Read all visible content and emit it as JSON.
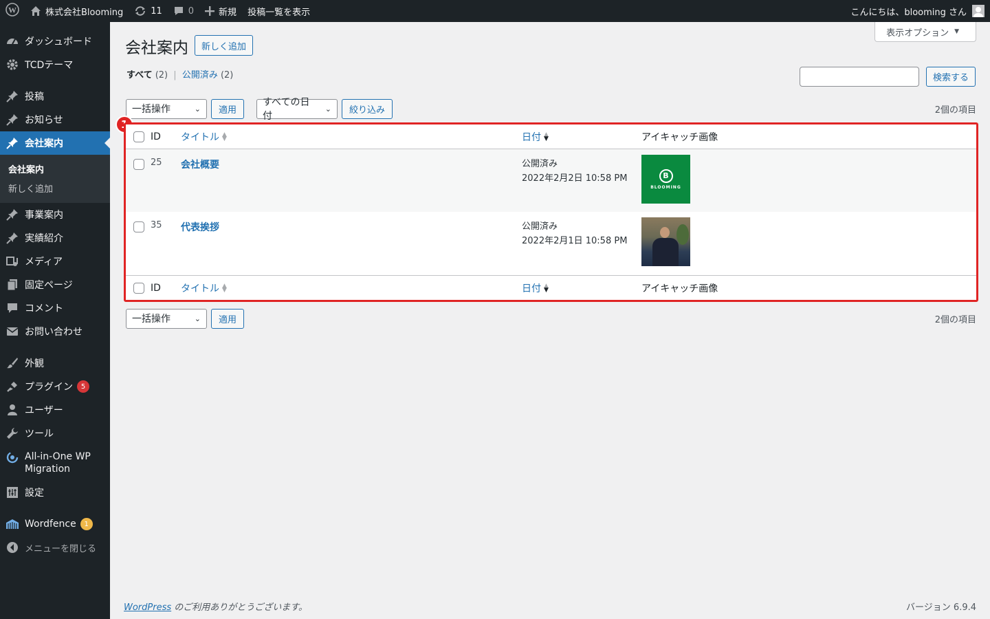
{
  "adminbar": {
    "site_name": "株式会社Blooming",
    "updates_count": "11",
    "comments_count": "0",
    "new_label": "新規",
    "view_posts_label": "投稿一覧を表示",
    "greeting": "こんにちは、blooming さん"
  },
  "sidebar": {
    "items": [
      {
        "label": "ダッシュボード",
        "icon": "dashboard-icon"
      },
      {
        "label": "TCDテーマ",
        "icon": "gear-icon"
      },
      {
        "label": "投稿",
        "icon": "pin-icon"
      },
      {
        "label": "お知らせ",
        "icon": "pin-icon"
      },
      {
        "label": "会社案内",
        "icon": "pin-icon",
        "current": true
      },
      {
        "label": "事業案内",
        "icon": "pin-icon"
      },
      {
        "label": "実績紹介",
        "icon": "pin-icon"
      },
      {
        "label": "メディア",
        "icon": "media-icon"
      },
      {
        "label": "固定ページ",
        "icon": "page-icon"
      },
      {
        "label": "コメント",
        "icon": "comment-icon"
      },
      {
        "label": "お問い合わせ",
        "icon": "mail-icon"
      },
      {
        "label": "外観",
        "icon": "brush-icon"
      },
      {
        "label": "プラグイン",
        "icon": "plugin-icon",
        "badge": "5"
      },
      {
        "label": "ユーザー",
        "icon": "user-icon"
      },
      {
        "label": "ツール",
        "icon": "wrench-icon"
      },
      {
        "label": "All-in-One WP Migration",
        "icon": "migration-icon"
      },
      {
        "label": "設定",
        "icon": "settings-icon"
      },
      {
        "label": "Wordfence",
        "icon": "wordfence-icon",
        "badge": "1"
      },
      {
        "label": "メニューを閉じる",
        "icon": "collapse-icon"
      }
    ],
    "submenu": [
      "会社案内",
      "新しく追加"
    ]
  },
  "screen_options": "表示オプション",
  "page_title": "会社案内",
  "add_new": "新しく追加",
  "filters": {
    "all_label": "すべて",
    "all_count": "(2)",
    "published_label": "公開済み",
    "published_count": "(2)",
    "separator": "|"
  },
  "search": {
    "button": "検索する",
    "value": ""
  },
  "bulk_action": "一括操作",
  "apply": "適用",
  "date_filter": "すべての日付",
  "filter_button": "絞り込み",
  "item_count": "2個の項目",
  "table": {
    "columns": {
      "id": "ID",
      "title": "タイトル",
      "date": "日付",
      "image": "アイキャッチ画像"
    },
    "rows": [
      {
        "id": "25",
        "title": "会社概要",
        "status": "公開済み",
        "date": "2022年2月2日 10:58 PM",
        "image": "blooming-logo"
      },
      {
        "id": "35",
        "title": "代表挨拶",
        "status": "公開済み",
        "date": "2022年2月1日 10:58 PM",
        "image": "portrait-photo"
      }
    ]
  },
  "marker": "1",
  "logo_text": {
    "letter": "B",
    "word": "BLOOMING"
  },
  "footer": {
    "wp_link": "WordPress",
    "thanks": " のご利用ありがとうございます。",
    "version": "バージョン 6.9.4"
  },
  "colors": {
    "accent": "#2271b1",
    "highlight": "#e02424",
    "plugin_badge": "#d63638",
    "wordfence_badge": "#f0b849"
  }
}
